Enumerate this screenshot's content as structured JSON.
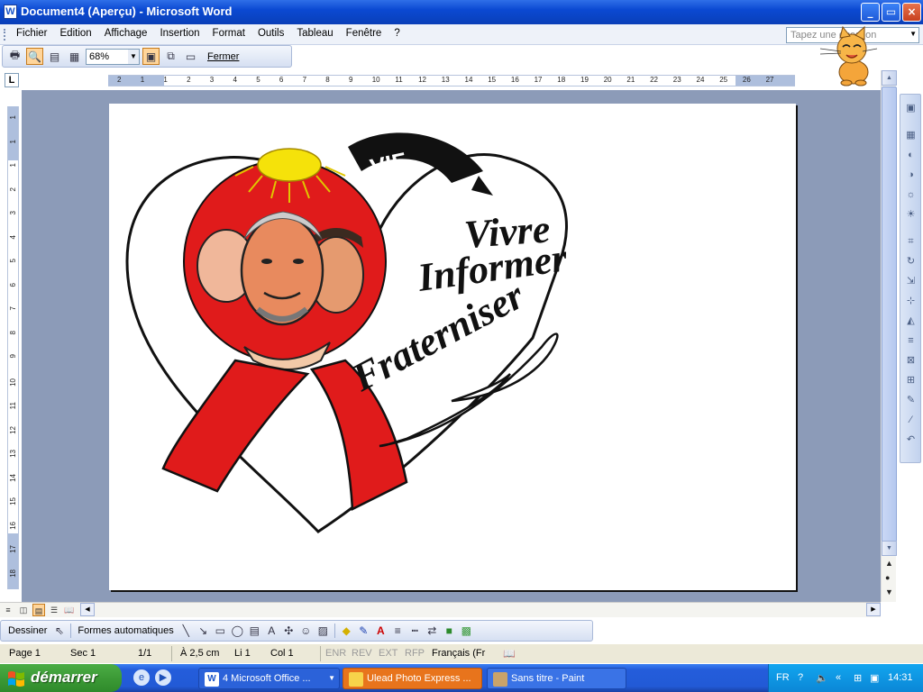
{
  "window": {
    "title": "Document4 (Aperçu) - Microsoft Word",
    "app_icon": "W",
    "minimize_label": "_",
    "maximize_label": "▭",
    "close_label": "×"
  },
  "menu": {
    "items": [
      "Fichier",
      "Edition",
      "Affichage",
      "Insertion",
      "Format",
      "Outils",
      "Tableau",
      "Fenêtre",
      "?"
    ],
    "help_placeholder": "Tapez une question"
  },
  "toolbar": {
    "zoom_value": "68%",
    "close_label": "Fermer"
  },
  "ruler": {
    "corner_label": "L",
    "horizontal_ticks": [
      "2",
      "1",
      "1",
      "2",
      "3",
      "4",
      "5",
      "6",
      "7",
      "8",
      "9",
      "10",
      "11",
      "12",
      "13",
      "14",
      "15",
      "16",
      "17",
      "18",
      "19",
      "20",
      "21",
      "22",
      "23",
      "24",
      "25",
      "26",
      "27"
    ],
    "vertical_ticks": [
      "1",
      "1",
      "1",
      "2",
      "3",
      "4",
      "5",
      "6",
      "7",
      "8",
      "9",
      "10",
      "11",
      "12",
      "13",
      "14",
      "15",
      "16",
      "17",
      "18"
    ]
  },
  "document": {
    "logo_text_1": "Vivre",
    "logo_text_2": "Informer",
    "logo_text_3": "Fraterniser",
    "logo_banner": "VIF",
    "colors": {
      "ribbon": "#e01b1b",
      "sun": "#f5e20a",
      "skin": "#e88a5e"
    }
  },
  "drawing_toolbar": {
    "draw_label": "Dessiner",
    "autoshapes_label": "Formes automatiques"
  },
  "statusbar": {
    "page": "Page 1",
    "section": "Sec 1",
    "pages": "1/1",
    "at": "À 2,5 cm",
    "line": "Li 1",
    "col": "Col 1",
    "enr": "ENR",
    "rev": "REV",
    "ext": "EXT",
    "rfp": "RFP",
    "language": "Français (Fr"
  },
  "taskbar": {
    "start_label": "démarrer",
    "tasks": [
      {
        "label": "4 Microsoft Office ...",
        "color": "#2b62d9"
      },
      {
        "label": "Ulead Photo Express ...",
        "color": "#e8741c"
      },
      {
        "label": "Sans titre - Paint",
        "color": "#3a73e6"
      }
    ],
    "lang": "FR",
    "clock": "14:31"
  }
}
